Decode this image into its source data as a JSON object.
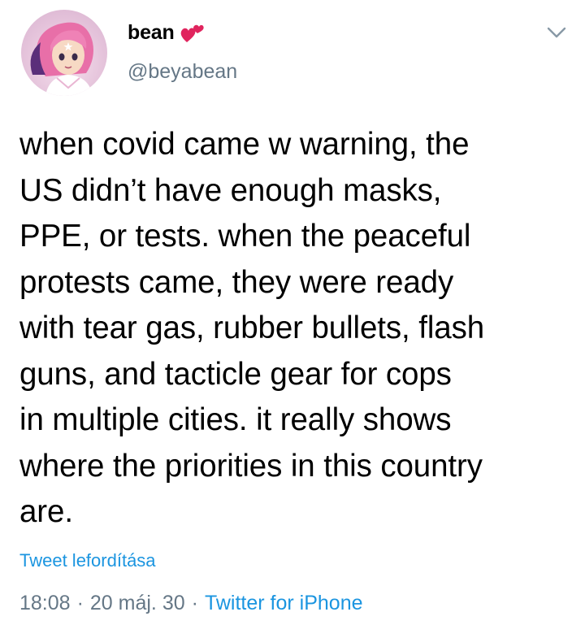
{
  "author": {
    "display_name": "bean",
    "name_emoji_icon": "two-hearts-emoji-icon",
    "handle": "@beyabean",
    "avatar_icon": "cartoon-avatar-pink-hair"
  },
  "tweet": {
    "text": "when covid came w warning, the\nUS didn’t have enough masks,\nPPE, or tests. when the peaceful\nprotests came, they were ready\nwith tear gas, rubber bullets, flash\nguns, and tacticle gear for cops\nin multiple cities. it really shows\nwhere the priorities in this country\nare.",
    "translate_label": "Tweet lefordítása",
    "time": "18:08",
    "date": "20 máj. 30",
    "separator": "·",
    "source": "Twitter for iPhone"
  },
  "colors": {
    "link": "#1b95e0",
    "secondary_text": "#657786",
    "heart": "#e0245e"
  }
}
